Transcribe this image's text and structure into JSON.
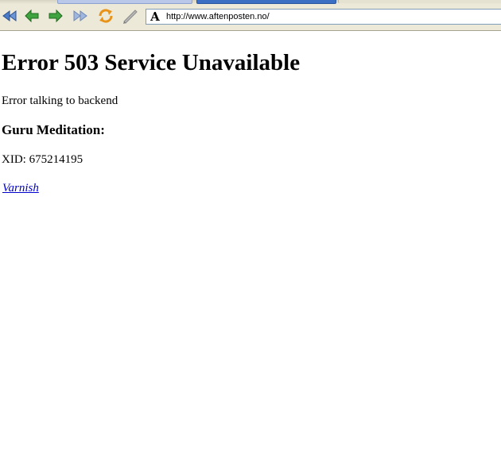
{
  "browser": {
    "toolbar": {
      "buttons": [
        {
          "name": "first",
          "icon": "double-arrow-left-icon"
        },
        {
          "name": "back",
          "icon": "arrow-left-icon"
        },
        {
          "name": "forward",
          "icon": "arrow-right-icon"
        },
        {
          "name": "last",
          "icon": "double-arrow-right-icon"
        },
        {
          "name": "reload",
          "icon": "reload-icon"
        },
        {
          "name": "edit",
          "icon": "pencil-icon"
        }
      ]
    },
    "address": {
      "url": "http://www.aftenposten.no/",
      "site_icon_glyph": "A"
    }
  },
  "page": {
    "heading": "Error 503 Service Unavailable",
    "message": "Error talking to backend",
    "subheading": "Guru Meditation:",
    "xid": "XID: 675214195",
    "link_text": "Varnish"
  },
  "colors": {
    "link": "#0000cc",
    "arrow_green": "#2e8b2e",
    "arrow_blue": "#4a7bc8",
    "reload_orange": "#e8921a"
  }
}
